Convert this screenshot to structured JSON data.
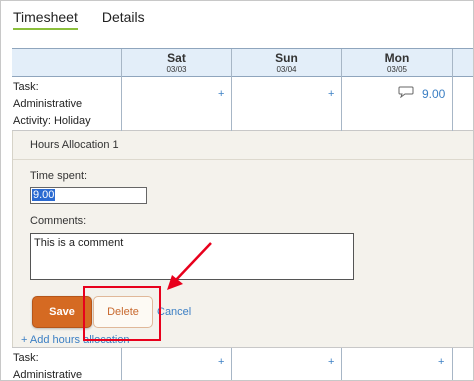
{
  "tabs": [
    {
      "label": "Timesheet",
      "active": true
    },
    {
      "label": "Details",
      "active": false
    }
  ],
  "days": [
    {
      "name": "Sat",
      "date": "03/03"
    },
    {
      "name": "Sun",
      "date": "03/04"
    },
    {
      "name": "Mon",
      "date": "03/05"
    }
  ],
  "row1": {
    "task_line1": "Task:",
    "task_line2": "Administrative",
    "task_line3": "Activity: Holiday",
    "add_sat": "+",
    "add_sun": "+",
    "mon_hours": "9.00",
    "comment_icon": "speech-bubble-icon"
  },
  "allocation": {
    "title": "Hours Allocation 1",
    "time_label": "Time spent:",
    "time_value": "9.00",
    "comments_label": "Comments:",
    "comments_value": "This is a comment",
    "save_label": "Save",
    "delete_label": "Delete",
    "cancel_label": "Cancel",
    "add_label": "+ Add hours allocation"
  },
  "row2": {
    "task_line1": "Task:",
    "task_line2": "Administrative",
    "add_sat": "+",
    "add_sun": "+",
    "add_mon": "+"
  },
  "colors": {
    "accent_tab": "#8bbf3c",
    "header_bg": "#e3eef9",
    "save_button": "#d56a22",
    "link": "#3b7fc4",
    "annotation_red": "#e8001c"
  }
}
